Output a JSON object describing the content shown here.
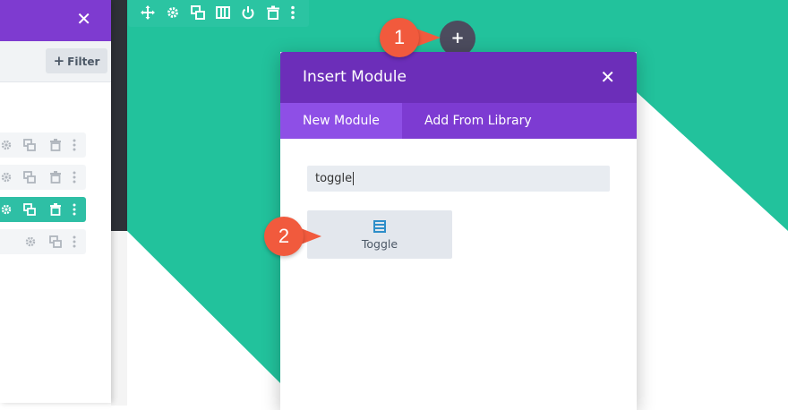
{
  "colors": {
    "teal": "#22c29c",
    "purple_header": "#6c2eb9",
    "purple_tabs": "#7d3bd2",
    "purple_tab_active": "#8e4fe6",
    "callout": "#f15a3d",
    "active_row": "#2ebfa5"
  },
  "layers_panel": {
    "close_icon": "close-icon",
    "filter_label": "Filter",
    "rows": [
      {
        "state": "default",
        "icons": [
          "gear-icon",
          "duplicate-icon",
          "trash-icon",
          "more-icon"
        ]
      },
      {
        "state": "default",
        "icons": [
          "gear-icon",
          "duplicate-icon",
          "trash-icon",
          "more-icon"
        ]
      },
      {
        "state": "active",
        "icons": [
          "gear-icon",
          "duplicate-icon",
          "trash-icon",
          "more-icon"
        ]
      },
      {
        "state": "default",
        "icons": [
          "gear-icon",
          "duplicate-icon",
          "more-icon"
        ]
      }
    ]
  },
  "row_toolbar": {
    "icons": [
      "move-icon",
      "gear-icon",
      "duplicate-icon",
      "columns-icon",
      "power-icon",
      "trash-icon",
      "more-icon"
    ]
  },
  "add_button": {
    "label": "+"
  },
  "callouts": [
    {
      "number": "1"
    },
    {
      "number": "2"
    }
  ],
  "modal": {
    "title": "Insert Module",
    "tabs": [
      {
        "label": "New Module",
        "active": true
      },
      {
        "label": "Add From Library",
        "active": false
      }
    ],
    "search": {
      "value": "toggle",
      "placeholder": ""
    },
    "results": [
      {
        "label": "Toggle",
        "icon": "toggle-icon"
      }
    ]
  }
}
